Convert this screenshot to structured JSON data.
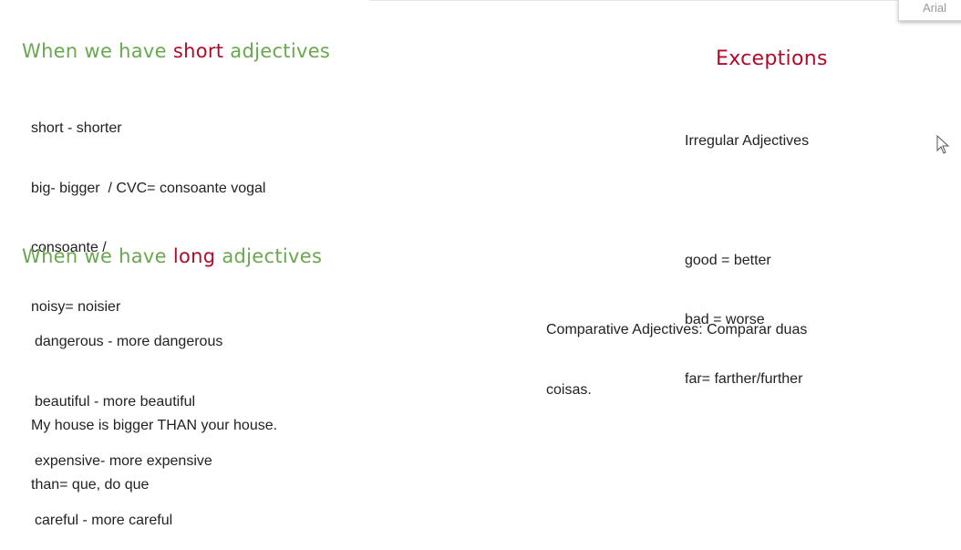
{
  "toolbar": {
    "font_name": "Arial"
  },
  "short_section": {
    "heading_pre": "When we have ",
    "heading_highlight": "short",
    "heading_post": " adjectives",
    "lines": [
      "short - shorter",
      "big- bigger  / CVC= consoante vogal",
      "consoante /",
      "noisy= noisier",
      "",
      "My house is bigger THAN your house.",
      "than= que, do que"
    ]
  },
  "long_section": {
    "heading_pre": "When we have ",
    "heading_highlight": "long",
    "heading_post": " adjectives",
    "lines": [
      "dangerous - more dangerous",
      "beautiful - more beautiful",
      "expensive- more expensive",
      "careful - more careful"
    ]
  },
  "exceptions": {
    "heading": "Exceptions",
    "lines": [
      "Irregular Adjectives",
      "",
      "good = better",
      "bad = worse",
      "far= farther/further"
    ]
  },
  "note": {
    "lines": [
      "Comparative Adjectives: Comparar duas",
      "coisas."
    ]
  },
  "colors": {
    "heading_green": "#6aa84f",
    "highlight_red": "#b10b2a",
    "text": "#222222"
  }
}
